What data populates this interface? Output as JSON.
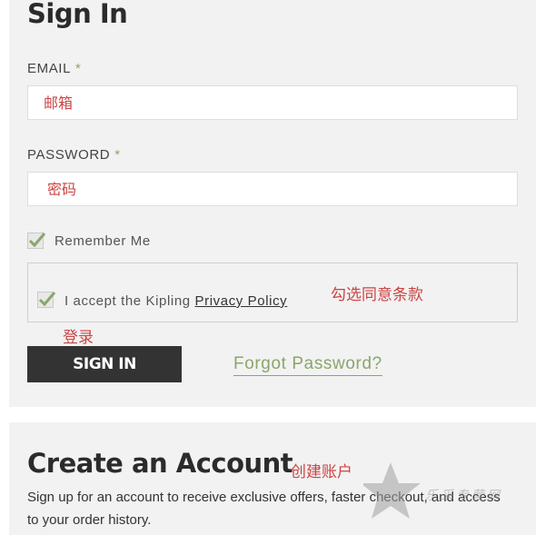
{
  "signin": {
    "title": "Sign In",
    "email_label": "EMAIL",
    "password_label": "PASSWORD",
    "required_mark": "*",
    "email_value": "邮箱",
    "password_value": "密码",
    "remember_label": "Remember Me",
    "remember_checked": true,
    "policy_prefix": "I accept the Kipling",
    "policy_link": "Privacy Policy",
    "policy_checked": true,
    "signin_button": "SIGN IN",
    "forgot_link": "Forgot Password?"
  },
  "annotations": {
    "agree_terms": "勾选同意条款",
    "login": "登录",
    "create_account": "创建账户"
  },
  "create": {
    "title": "Create an Account",
    "description": "Sign up for an account to receive exclusive offers, faster checkout, and access to your order history."
  },
  "watermark": {
    "icon": "star-icon",
    "text": "乐采专营网"
  },
  "colors": {
    "accent_green": "#8aa66a",
    "button_dark": "#333333",
    "annotation_red": "#cc4444",
    "panel_bg": "#f2f2f2"
  }
}
